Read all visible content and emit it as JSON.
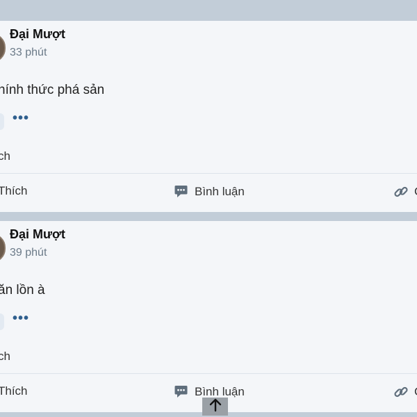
{
  "posts": [
    {
      "author": "Đại Mượt",
      "time": "33 phút",
      "text": "hính thức phá sản",
      "more": "•••",
      "likes": "ch",
      "actions": {
        "like": "Thích",
        "comment": "Bình luận",
        "share": "C"
      }
    },
    {
      "author": "Đại Mượt",
      "time": "39 phút",
      "text": "ăn lồn à",
      "more": "•••",
      "likes": "ch",
      "actions": {
        "like": "Thích",
        "comment": "Bình luận",
        "share": "C"
      }
    }
  ],
  "icons": {
    "comment": "comment-icon",
    "share": "link-icon",
    "scroll_top": "arrow-up-icon"
  },
  "colors": {
    "feed_background": "#c2cdd8",
    "card_background": "#f4f6f9",
    "accent": "#2f5f8e"
  }
}
